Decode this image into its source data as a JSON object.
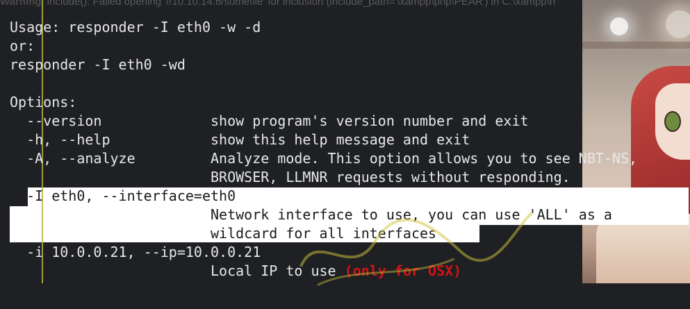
{
  "warning_banner": {
    "label": "Warning",
    "text": ": include(): Failed opening '//10.10.14.6/somefile' for inclusion (include_path='\\xampp\\php\\PEAR') in C:\\xampp\\h"
  },
  "terminal": {
    "lines": [
      "Usage: responder -I eth0 -w -d",
      "or:",
      "responder -I eth0 -wd",
      "",
      "Options:",
      "  --version             show program's version number and exit",
      "  -h, --help            show this help message and exit",
      "  -A, --analyze         Analyze mode. This option allows you to see NBT-NS,",
      "                        BROWSER, LLMNR requests without responding.",
      "  -I eth0, --interface=eth0",
      "                        Network interface to use, you can use 'ALL' as a",
      "                        wildcard for all interfaces",
      "  -i 10.0.0.21, --ip=10.0.0.21",
      "                        Local IP to use "
    ],
    "osx_note": "(only for OSX)"
  },
  "colors": {
    "terminal_bg": "#1e2024",
    "terminal_fg": "#e8e8e8",
    "selection_bg": "#ffffff",
    "note_red": "#d01414",
    "guide_line": "#b7b341"
  }
}
